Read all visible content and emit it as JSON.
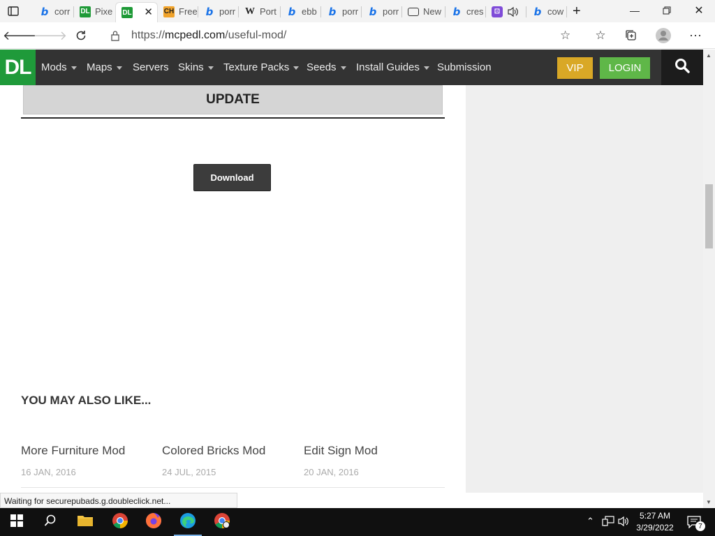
{
  "browser": {
    "tabs": [
      {
        "favicon": "bing-icon",
        "label": "corr"
      },
      {
        "favicon": "dl-icon",
        "label": "Pixe"
      },
      {
        "favicon": "dl-icon",
        "label": "",
        "active": true
      },
      {
        "favicon": "ch-icon",
        "label": "Free"
      },
      {
        "favicon": "bing-icon",
        "label": "porr"
      },
      {
        "favicon": "wikipedia-icon",
        "label": "Port"
      },
      {
        "favicon": "bing-icon",
        "label": "ebb"
      },
      {
        "favicon": "bing-icon",
        "label": "porr"
      },
      {
        "favicon": "bing-icon",
        "label": "porr"
      },
      {
        "favicon": "newtab-icon",
        "label": "New"
      },
      {
        "favicon": "bing-icon",
        "label": "cres"
      },
      {
        "favicon": "twitch-icon",
        "label": ""
      },
      {
        "favicon": "bing-icon",
        "label": "cow"
      }
    ],
    "url_prefix": "https://",
    "url_host": "mcpedl.com",
    "url_path": "/useful-mod/"
  },
  "site": {
    "logo": "DL",
    "nav": [
      {
        "label": "Mods",
        "has_dropdown": true
      },
      {
        "label": "Maps",
        "has_dropdown": true
      },
      {
        "label": "Servers",
        "has_dropdown": false
      },
      {
        "label": "Skins",
        "has_dropdown": true
      },
      {
        "label": "Texture Packs",
        "has_dropdown": true
      },
      {
        "label": "Seeds",
        "has_dropdown": true
      },
      {
        "label": "Install Guides",
        "has_dropdown": true
      },
      {
        "label": "Submission",
        "has_dropdown": false
      }
    ],
    "vip_label": "VIP",
    "login_label": "LOGIN",
    "colors": {
      "nav_bg": "#333333",
      "logo_bg": "#1f9a3a",
      "vip": "#d9a826",
      "login": "#5fb748"
    }
  },
  "content": {
    "update_label": "UPDATE",
    "download_label": "Download",
    "related_title": "YOU MAY ALSO LIKE...",
    "related": [
      {
        "name": "More Furniture Mod",
        "date": "16 JAN, 2016"
      },
      {
        "name": "Colored Bricks Mod",
        "date": "24 JUL, 2015"
      },
      {
        "name": "Edit Sign Mod",
        "date": "20 JAN, 2016"
      }
    ]
  },
  "status_text": "Waiting for securepubads.g.doubleclick.net...",
  "taskbar": {
    "time": "5:27 AM",
    "date": "3/29/2022",
    "notification_count": "7"
  }
}
